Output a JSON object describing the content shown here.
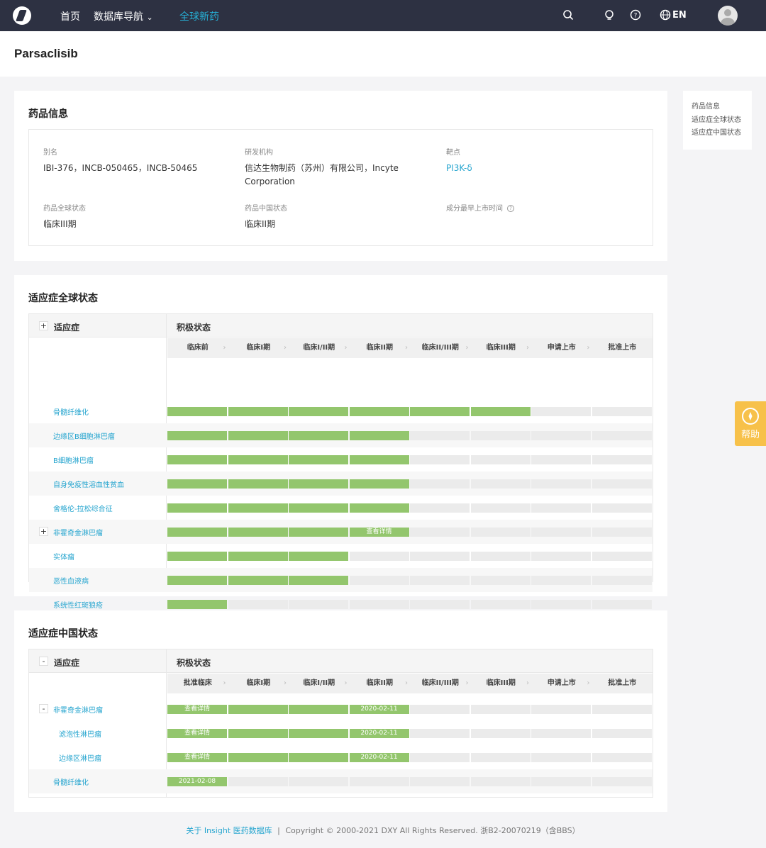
{
  "nav": {
    "items": [
      "首页",
      "数据库导航",
      "全球新药"
    ],
    "dropdown_glyph": "⌄",
    "lang": "EN",
    "icons": [
      "search-icon",
      "bulb-icon",
      "help-circle-icon",
      "globe-icon"
    ]
  },
  "page": {
    "title": "Parsaclisib"
  },
  "drug_info": {
    "title": "药品信息",
    "alias_label": "别名",
    "alias": "IBI-376，INCB-050465，INCB-50465",
    "org_label": "研发机构",
    "org_line1": "信达生物制药（苏州）有限公司，Incyte",
    "org_line2": "Corporation",
    "target_label": "靶点",
    "target": "PI3K-δ",
    "global_status_label": "药品全球状态",
    "global_status": "临床III期",
    "china_status_label": "药品中国状态",
    "china_status": "临床II期",
    "first_launch_label": "成分最早上市时间",
    "first_launch_help": "?"
  },
  "anchor_nav": [
    "药品信息",
    "适应症全球状态",
    "适应症中国状态"
  ],
  "help": {
    "label": "帮助"
  },
  "global_table": {
    "title": "适应症全球状态",
    "col_indication": "适应症",
    "col_status": "积极状态",
    "expand_glyph": "+",
    "stages": [
      "临床前",
      "临床I期",
      "临床I/II期",
      "临床II期",
      "临床II/III期",
      "临床III期",
      "申请上市",
      "批准上市"
    ],
    "rows": [
      {
        "name": "骨髓纤维化",
        "filled": 6,
        "expandable": false,
        "labels": []
      },
      {
        "name": "边缘区B细胞淋巴瘤",
        "filled": 4,
        "expandable": false,
        "labels": []
      },
      {
        "name": "B细胞淋巴瘤",
        "filled": 4,
        "expandable": false,
        "labels": []
      },
      {
        "name": "自身免疫性溶血性贫血",
        "filled": 4,
        "expandable": false,
        "labels": []
      },
      {
        "name": "舍格伦-拉松综合征",
        "filled": 4,
        "expandable": false,
        "labels": []
      },
      {
        "name": "非霍奇金淋巴瘤",
        "filled": 4,
        "expandable": true,
        "labels": [
          {
            "stage": 3,
            "text": "查看详情"
          }
        ]
      },
      {
        "name": "实体瘤",
        "filled": 3,
        "expandable": false,
        "labels": []
      },
      {
        "name": "恶性血液病",
        "filled": 3,
        "expandable": false,
        "labels": []
      },
      {
        "name": "系统性红斑狼疮",
        "filled": 1,
        "expandable": false,
        "labels": []
      }
    ]
  },
  "china_table": {
    "title": "适应症中国状态",
    "col_indication": "适应症",
    "col_status": "积极状态",
    "collapse_glyph": "-",
    "stages": [
      "批准临床",
      "临床I期",
      "临床I/II期",
      "临床II期",
      "临床II/III期",
      "临床III期",
      "申请上市",
      "批准上市"
    ],
    "rows": [
      {
        "name": "非霍奇金淋巴瘤",
        "filled": 4,
        "expandable": true,
        "child": false,
        "labels": [
          {
            "stage": 0,
            "text": "查看详情"
          },
          {
            "stage": 3,
            "text": "2020-02-11"
          }
        ]
      },
      {
        "name": "滤泡性淋巴瘤",
        "filled": 4,
        "expandable": false,
        "child": true,
        "labels": [
          {
            "stage": 0,
            "text": "查看详情"
          },
          {
            "stage": 3,
            "text": "2020-02-11"
          }
        ]
      },
      {
        "name": "边缘区淋巴瘤",
        "filled": 4,
        "expandable": false,
        "child": true,
        "labels": [
          {
            "stage": 0,
            "text": "查看详情"
          },
          {
            "stage": 3,
            "text": "2020-02-11"
          }
        ]
      },
      {
        "name": "骨髓纤维化",
        "filled": 1,
        "expandable": false,
        "child": false,
        "labels": [
          {
            "stage": 0,
            "text": "2021-02-08"
          }
        ]
      }
    ]
  },
  "footer": {
    "link": "关于 Insight 医药数据库",
    "sep": "|",
    "copyright": "Copyright © 2000-2021 DXY All Rights Reserved. 浙B2-20070219（含BBS）"
  },
  "colors": {
    "nav_bg": "#2d3142",
    "accent": "#26b0d6",
    "bar_green": "#93c66d",
    "bar_empty": "#ebebeb",
    "help_bg": "#f7c14a"
  }
}
